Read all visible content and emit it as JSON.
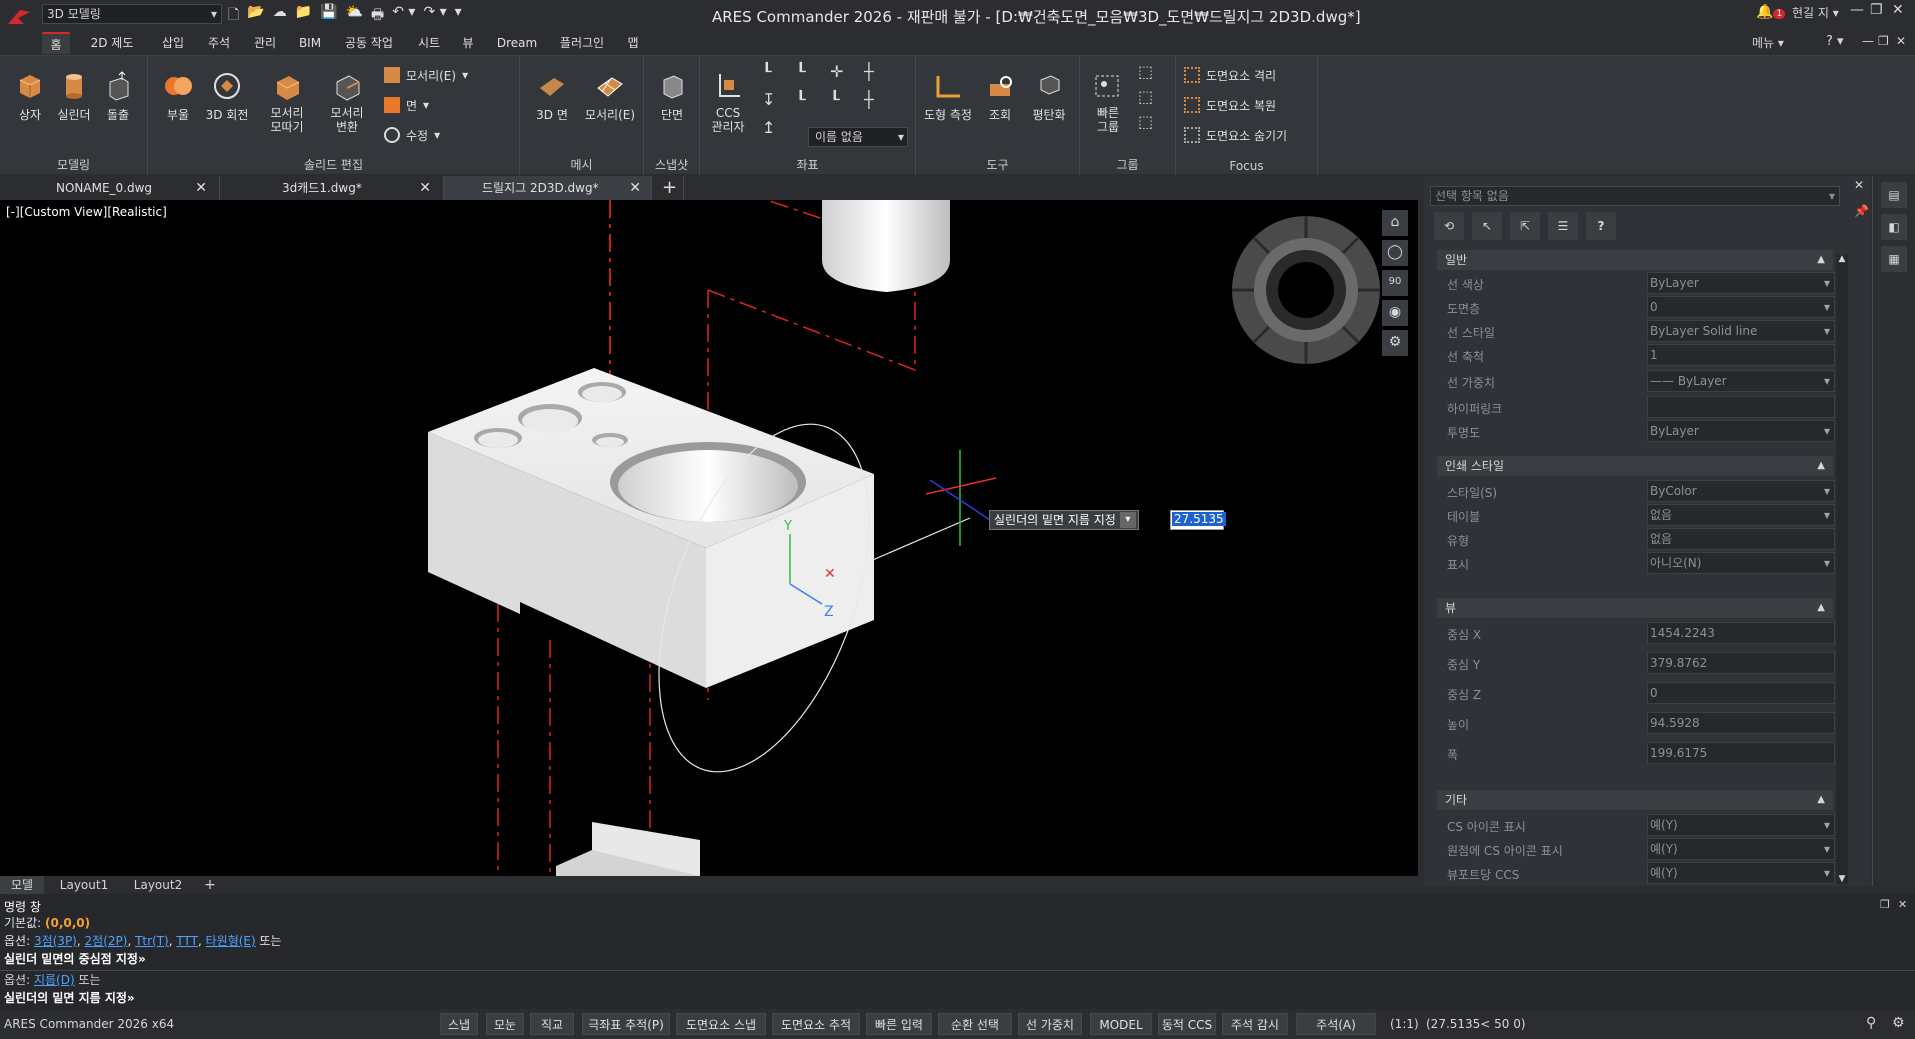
{
  "titlebar": {
    "workspace": "3D 모델링",
    "title": "ARES Commander 2026 - 재판매 불가 - [D:₩건축도면_모음₩3D_도면₩드릴지그 2D3D.dwg*]",
    "notification_count": "1",
    "user": "현길 지",
    "menu_label": "메뉴",
    "help": "?"
  },
  "ribbon_tabs": [
    "홈",
    "2D 제도",
    "삽입",
    "주석",
    "관리",
    "BIM",
    "공동 작업",
    "시트",
    "뷰",
    "Dream",
    "플러그인",
    "맵"
  ],
  "ribbon": {
    "modeling": {
      "title": "모델링",
      "buttons": [
        "상자",
        "실린더",
        "돌출"
      ]
    },
    "solid_edit": {
      "title": "솔리드 편집",
      "buttons": [
        "부울",
        "3D 회전",
        "모서리\n모따기",
        "모서리\n변환"
      ],
      "small": [
        "모서리(E)",
        "면",
        "수정"
      ]
    },
    "mesh": {
      "title": "메시",
      "buttons": [
        "3D 면",
        "모서리(E)"
      ]
    },
    "section": {
      "title": "스냅샷",
      "buttons": [
        "단면"
      ]
    },
    "coords": {
      "title": "좌표",
      "buttons": [
        "CCS\n관리자"
      ],
      "named": "이름 없음"
    },
    "tools": {
      "title": "도구",
      "buttons": [
        "도형 측정",
        "조회",
        "평탄화"
      ]
    },
    "group": {
      "title": "그룹",
      "buttons": [
        "빠른\n그룹"
      ]
    },
    "focus": {
      "title": "Focus",
      "items": [
        "도면요소 격리",
        "도면요소 복원",
        "도면요소 숨기기"
      ]
    }
  },
  "doc_tabs": [
    "NONAME_0.dwg",
    "3d캐드1.dwg*",
    "드릴지그 2D3D.dwg*"
  ],
  "viewport": {
    "label": "[-][Custom View][Realistic]",
    "tooltip": "실린더의 밑면 지름 지정",
    "input_value": "27.5135",
    "navcube_label": "90"
  },
  "layout_tabs": [
    "모델",
    "Layout1",
    "Layout2"
  ],
  "properties": {
    "selection": "선택 항목 없음",
    "sections": [
      {
        "title": "일반",
        "rows": [
          {
            "label": "선 색상",
            "value": "ByLayer",
            "dd": true
          },
          {
            "label": "도면층",
            "value": "0",
            "dd": true
          },
          {
            "label": "선 스타일",
            "value": "ByLayer    Solid line",
            "dd": true
          },
          {
            "label": "선 축척",
            "value": "1",
            "dd": false
          },
          {
            "label": "선 가중치",
            "value": "—— ByLayer",
            "dd": true
          },
          {
            "label": "하이퍼링크",
            "value": "",
            "dd": false
          },
          {
            "label": "투명도",
            "value": "ByLayer",
            "dd": true
          }
        ]
      },
      {
        "title": "인쇄 스타일",
        "rows": [
          {
            "label": "스타일(S)",
            "value": "ByColor",
            "dd": true
          },
          {
            "label": "테이블",
            "value": "없음",
            "dd": true
          },
          {
            "label": "유형",
            "value": "없음",
            "dd": false
          },
          {
            "label": "표시",
            "value": "아니오(N)",
            "dd": true
          }
        ]
      },
      {
        "title": "뷰",
        "rows": [
          {
            "label": "중심 X",
            "value": "1454.2243",
            "dd": false
          },
          {
            "label": "중심 Y",
            "value": "379.8762",
            "dd": false
          },
          {
            "label": "중심 Z",
            "value": "0",
            "dd": false
          },
          {
            "label": "높이",
            "value": "94.5928",
            "dd": false
          },
          {
            "label": "폭",
            "value": "199.6175",
            "dd": false
          }
        ]
      },
      {
        "title": "기타",
        "rows": [
          {
            "label": "CS 아이콘 표시",
            "value": "예(Y)",
            "dd": true
          },
          {
            "label": "원점에 CS 아이콘 표시",
            "value": "예(Y)",
            "dd": true
          },
          {
            "label": "뷰포트당 CCS",
            "value": "예(Y)",
            "dd": true
          }
        ]
      }
    ]
  },
  "command": {
    "title": "명령 창",
    "line1_label": "기본값:",
    "line1_value": "(0,0,0)",
    "line2_prefix": "옵션:",
    "line2_options": [
      "3점(3P)",
      "2점(2P)",
      "Ttr(T)",
      "TTT",
      "타원형(E)"
    ],
    "line2_suffix": "또는",
    "line3": "실린더 밑면의 중심점 지정»",
    "line4_prefix": "옵션:",
    "line4_option": "지름(D)",
    "line4_suffix": "또는",
    "line5": "실린더의 밑면 지름 지정»"
  },
  "status": {
    "app": "ARES Commander 2026 x64",
    "buttons": [
      "스냅",
      "모눈",
      "직교",
      "극좌표 추적(P)",
      "도면요소 스냅",
      "도면요소 추적",
      "빠른 입력",
      "순환 선택",
      "선 가중치",
      "MODEL",
      "동적 CCS",
      "주석 감시",
      "주석(A)"
    ],
    "scale": "(1:1)",
    "coords": "(27.5135< 50 0)"
  }
}
